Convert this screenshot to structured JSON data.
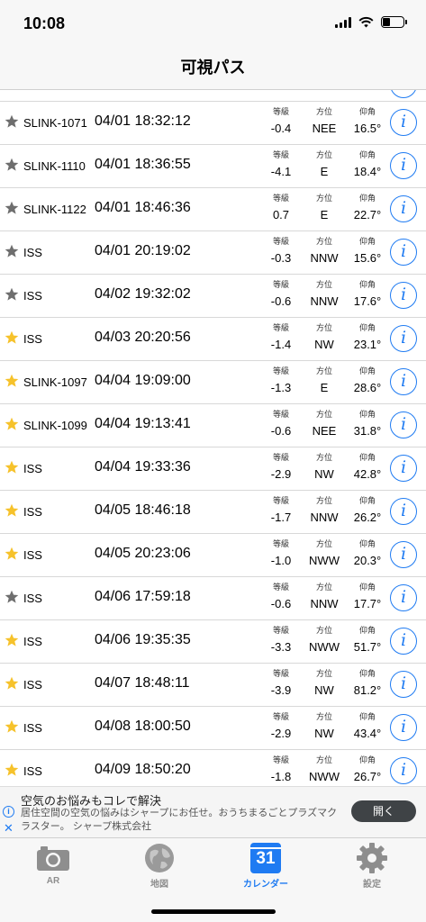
{
  "status": {
    "time": "10:08"
  },
  "nav": {
    "title": "可視パス"
  },
  "col_labels": {
    "mag": "等級",
    "dir": "方位",
    "elev": "仰角"
  },
  "colors": {
    "star_gray": "#6e6e6e",
    "star_gold": "#f6c22b",
    "accent": "#1f7bf2"
  },
  "passes": [
    {
      "name": "SLINK-1071",
      "datetime": "04/01 18:32:12",
      "mag": "-0.4",
      "dir": "NEE",
      "elev": "16.5°",
      "star": "gray"
    },
    {
      "name": "SLINK-1110",
      "datetime": "04/01 18:36:55",
      "mag": "-4.1",
      "dir": "E",
      "elev": "18.4°",
      "star": "gray"
    },
    {
      "name": "SLINK-1122",
      "datetime": "04/01 18:46:36",
      "mag": "0.7",
      "dir": "E",
      "elev": "22.7°",
      "star": "gray"
    },
    {
      "name": "ISS",
      "datetime": "04/01 20:19:02",
      "mag": "-0.3",
      "dir": "NNW",
      "elev": "15.6°",
      "star": "gray"
    },
    {
      "name": "ISS",
      "datetime": "04/02 19:32:02",
      "mag": "-0.6",
      "dir": "NNW",
      "elev": "17.6°",
      "star": "gray"
    },
    {
      "name": "ISS",
      "datetime": "04/03 20:20:56",
      "mag": "-1.4",
      "dir": "NW",
      "elev": "23.1°",
      "star": "gold"
    },
    {
      "name": "SLINK-1097",
      "datetime": "04/04 19:09:00",
      "mag": "-1.3",
      "dir": "E",
      "elev": "28.6°",
      "star": "gold"
    },
    {
      "name": "SLINK-1099",
      "datetime": "04/04 19:13:41",
      "mag": "-0.6",
      "dir": "NEE",
      "elev": "31.8°",
      "star": "gold"
    },
    {
      "name": "ISS",
      "datetime": "04/04 19:33:36",
      "mag": "-2.9",
      "dir": "NW",
      "elev": "42.8°",
      "star": "gold"
    },
    {
      "name": "ISS",
      "datetime": "04/05 18:46:18",
      "mag": "-1.7",
      "dir": "NNW",
      "elev": "26.2°",
      "star": "gold"
    },
    {
      "name": "ISS",
      "datetime": "04/05 20:23:06",
      "mag": "-1.0",
      "dir": "NWW",
      "elev": "20.3°",
      "star": "gold"
    },
    {
      "name": "ISS",
      "datetime": "04/06 17:59:18",
      "mag": "-0.6",
      "dir": "NNW",
      "elev": "17.7°",
      "star": "gray"
    },
    {
      "name": "ISS",
      "datetime": "04/06 19:35:35",
      "mag": "-3.3",
      "dir": "NWW",
      "elev": "51.7°",
      "star": "gold"
    },
    {
      "name": "ISS",
      "datetime": "04/07 18:48:11",
      "mag": "-3.9",
      "dir": "NW",
      "elev": "81.2°",
      "star": "gold"
    },
    {
      "name": "ISS",
      "datetime": "04/08 18:00:50",
      "mag": "-2.9",
      "dir": "NW",
      "elev": "43.4°",
      "star": "gold"
    },
    {
      "name": "ISS",
      "datetime": "04/09 18:50:20",
      "mag": "-1.8",
      "dir": "NWW",
      "elev": "26.7°",
      "star": "gold"
    }
  ],
  "ad": {
    "title": "空気のお悩みもコレで解決",
    "description": "居住空間の空気の悩みはシャープにお任せ。おうちまるごとプラズマクラスター。 シャープ株式会社",
    "button": "開く"
  },
  "tabs": [
    {
      "id": "ar",
      "label": "AR",
      "icon": "camera-icon"
    },
    {
      "id": "map",
      "label": "地図",
      "icon": "globe-icon"
    },
    {
      "id": "calendar",
      "label": "カレンダー",
      "icon": "calendar-icon",
      "badge": "31",
      "active": true
    },
    {
      "id": "settings",
      "label": "設定",
      "icon": "gear-icon"
    }
  ]
}
